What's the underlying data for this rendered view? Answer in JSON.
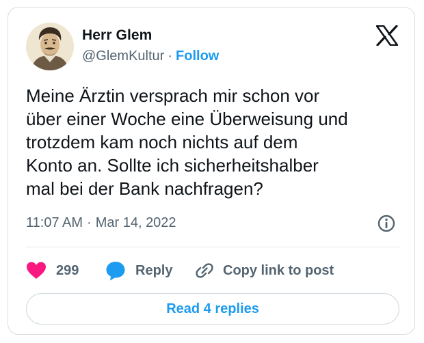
{
  "author": {
    "name": "Herr Glem",
    "handle": "@GlemKultur",
    "separator": "·",
    "follow_label": "Follow"
  },
  "logo": {
    "icon": "x-logo-icon"
  },
  "post": {
    "text": "Meine Ärztin versprach mir schon vor\nüber einer Woche eine Überweisung und\ntrotzdem kam noch nichts auf dem\nKonto an. Sollte ich sicherheitshalber\nmal bei der Bank nachfragen?",
    "time": "11:07 AM",
    "separator": "·",
    "date": "Mar 14, 2022"
  },
  "actions": {
    "like_count": "299",
    "reply_label": "Reply",
    "copy_label": "Copy link to post"
  },
  "read_replies_label": "Read 4 replies",
  "colors": {
    "accent": "#1d9bf0",
    "like": "#f91880",
    "text": "#0f1419",
    "muted": "#536471"
  }
}
